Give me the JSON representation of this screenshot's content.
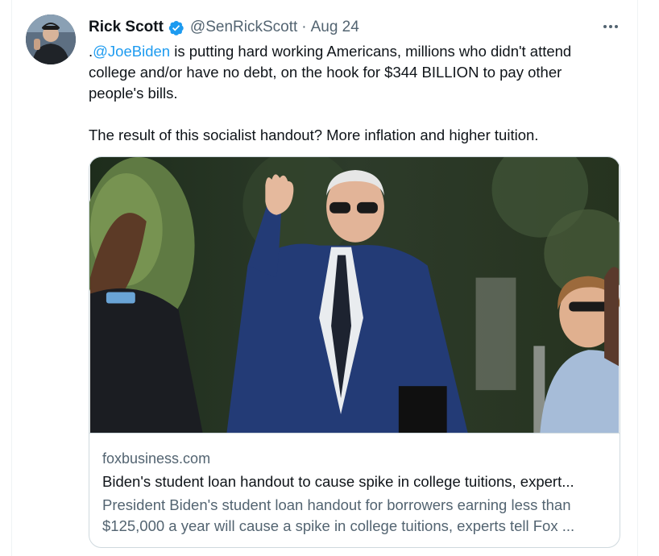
{
  "tweet": {
    "author": {
      "display_name": "Rick Scott",
      "handle": "@SenRickScott",
      "verified": true,
      "avatar_icon": "user-avatar-photo"
    },
    "separator": "·",
    "date": "Aug 24",
    "more_icon": "more-options-icon",
    "text": {
      "mention_prefix": ".",
      "mention": "@JoeBiden",
      "line1_rest": " is putting hard working Americans, millions who didn't attend",
      "line2": "college and/or have no debt, on the hook for $344 BILLION to pay other",
      "line3": "people's bills.",
      "line4": "The result of this socialist handout? More inflation and higher tuition."
    },
    "link_card": {
      "image_icon": "article-photo",
      "domain": "foxbusiness.com",
      "title": "Biden's student loan handout to cause spike in college tuitions, expert...",
      "description_line1": "President Biden's student loan handout for borrowers earning less than",
      "description_line2": "$125,000 a year will cause a spike in college tuitions, experts tell Fox ..."
    }
  },
  "colors": {
    "accent": "#1d9bf0",
    "text_primary": "#0f1419",
    "text_secondary": "#536471",
    "border": "#cfd9de"
  }
}
